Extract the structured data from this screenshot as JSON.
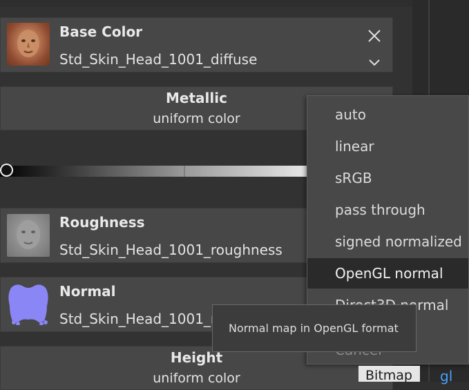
{
  "slots": {
    "base_color": {
      "title": "Base Color",
      "file": "Std_Skin_Head_1001_diffuse"
    },
    "metallic": {
      "title": "Metallic",
      "mode": "uniform color",
      "value": 0.0
    },
    "roughness": {
      "title": "Roughness",
      "file": "Std_Skin_Head_1001_roughness"
    },
    "normal": {
      "title": "Normal",
      "file": "Std_Skin_Head_1001_normal"
    },
    "height": {
      "title": "Height",
      "mode": "uniform color"
    }
  },
  "colorspace_menu": {
    "items": [
      "auto",
      "linear",
      "sRGB",
      "pass through",
      "signed normalized",
      "OpenGL normal",
      "Direct3D normal",
      "Cancel"
    ],
    "selected": "OpenGL normal"
  },
  "tooltip": "Normal map in OpenGL format",
  "bottom_tabs": {
    "bitmap": "Bitmap",
    "gl": "gl"
  }
}
